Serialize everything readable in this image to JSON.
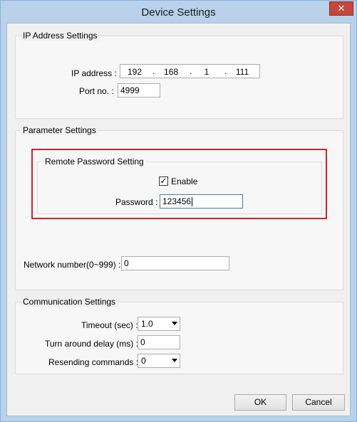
{
  "window": {
    "title": "Device Settings",
    "close_label": "✕"
  },
  "ip_settings": {
    "group_label": "IP Address Settings",
    "ip_label": "IP address :",
    "ip_octets": [
      "192",
      "168",
      "1",
      "111"
    ],
    "port_label": "Port no. :",
    "port_value": "4999"
  },
  "param_settings": {
    "group_label": "Parameter Settings",
    "remote": {
      "group_label": "Remote Password Setting",
      "enable_label": "Enable",
      "enable_checked": true,
      "password_label": "Password :",
      "password_value": "123456"
    },
    "network_label": "Network number(0~999) :",
    "network_value": "0"
  },
  "comm_settings": {
    "group_label": "Communication Settings",
    "timeout_label": "Timeout (sec) :",
    "timeout_value": "1.0",
    "turnaround_label": "Turn around delay (ms) :",
    "turnaround_value": "0",
    "resend_label": "Resending commands :",
    "resend_value": "0"
  },
  "buttons": {
    "ok": "OK",
    "cancel": "Cancel"
  },
  "colors": {
    "highlight": "#d2232a",
    "close_button": "#c7463a",
    "title_bar": "#b9d1ea"
  }
}
